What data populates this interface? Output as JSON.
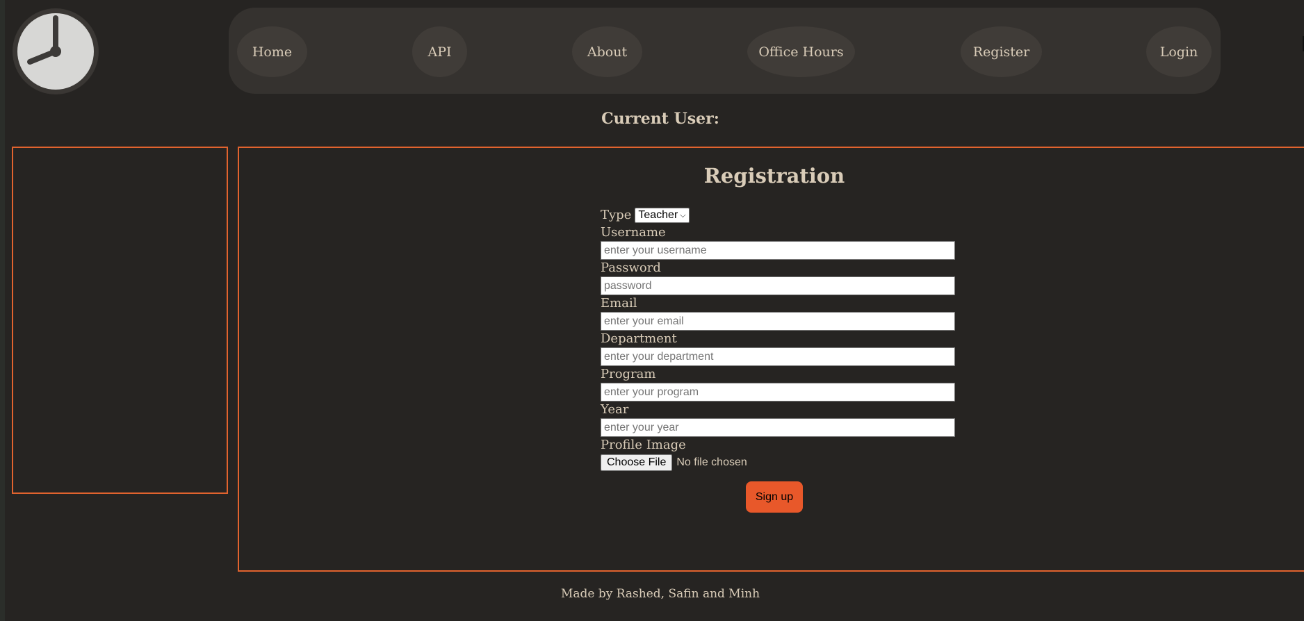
{
  "nav": {
    "items": [
      {
        "label": "Home"
      },
      {
        "label": "API"
      },
      {
        "label": "About"
      },
      {
        "label": "Office Hours"
      },
      {
        "label": "Register"
      },
      {
        "label": "Login"
      }
    ]
  },
  "current_user": {
    "label": "Current User:"
  },
  "registration": {
    "title": "Registration",
    "type_label": "Type",
    "type_value": "Teacher",
    "fields": [
      {
        "label": "Username",
        "placeholder": "enter your username"
      },
      {
        "label": "Password",
        "placeholder": "password"
      },
      {
        "label": "Email",
        "placeholder": "enter your email"
      },
      {
        "label": "Department",
        "placeholder": "enter your department"
      },
      {
        "label": "Program",
        "placeholder": "enter your program"
      },
      {
        "label": "Year",
        "placeholder": "enter your year"
      }
    ],
    "profile_image_label": "Profile Image",
    "choose_file_label": "Choose File",
    "file_status": "No file chosen",
    "signup_label": "Sign up"
  },
  "footer": {
    "text": "Made by Rashed, Safin and Minh"
  },
  "colors": {
    "background": "#262422",
    "navbar": "#35322f",
    "accent_border": "#e1632e",
    "signup_button": "#e8582a",
    "text": "#d9ccb8"
  },
  "icons": {
    "logo": "clock-icon"
  }
}
